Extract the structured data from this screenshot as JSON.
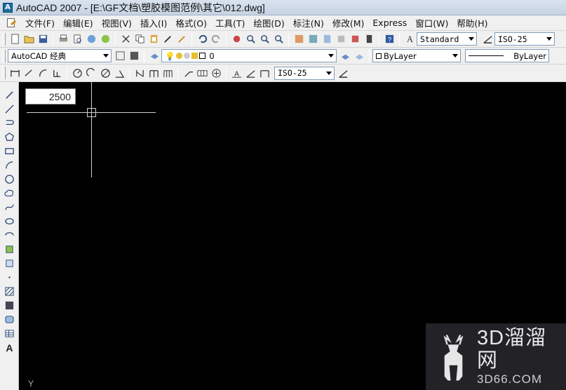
{
  "window": {
    "title": "AutoCAD 2007 - [E:\\GF文档\\塑胶模图范例\\其它\\012.dwg]"
  },
  "menu": [
    "文件(F)",
    "编辑(E)",
    "视图(V)",
    "插入(I)",
    "格式(O)",
    "工具(T)",
    "绘图(D)",
    "标注(N)",
    "修改(M)",
    "Express",
    "窗口(W)",
    "帮助(H)"
  ],
  "toolbar1": {
    "text_style": "Standard",
    "dim_style": "ISO-25"
  },
  "toolbar2": {
    "workspace": "AutoCAD 经典",
    "layer": "0",
    "color": "ByLayer",
    "linetype": "ByLayer"
  },
  "toolbar3": {
    "dim_style": "ISO-25"
  },
  "canvas": {
    "dynamic_input_value": "2500",
    "ucs_label": "Y",
    "background": "#000000"
  },
  "watermark": {
    "big": "3D溜溜网",
    "small": "3D66.COM"
  },
  "colors": {
    "toolbar_bg": "#f0f0f0",
    "title_bg": "#d9e3ef",
    "canvas": "#000000"
  }
}
